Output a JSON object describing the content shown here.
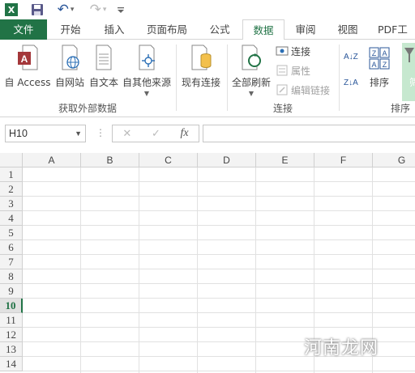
{
  "qat": {
    "logo_text": "X",
    "undo_symbol": "↶",
    "redo_symbol": "↷",
    "dropdown_symbol": "▾"
  },
  "tabs": [
    {
      "label": "文件"
    },
    {
      "label": "开始"
    },
    {
      "label": "插入"
    },
    {
      "label": "页面布局"
    },
    {
      "label": "公式"
    },
    {
      "label": "数据"
    },
    {
      "label": "审阅"
    },
    {
      "label": "视图"
    },
    {
      "label": "PDF工具"
    }
  ],
  "active_tab": "数据",
  "ribbon": {
    "get_external": {
      "buttons": [
        {
          "label": "自 Access"
        },
        {
          "label": "自网站"
        },
        {
          "label": "自文本"
        },
        {
          "label": "自其他来源"
        }
      ],
      "group_label": "获取外部数据"
    },
    "existing_connections": {
      "label": "现有连接"
    },
    "connections": {
      "refresh_all": "全部刷新",
      "connect": "连接",
      "properties": "属性",
      "edit_links": "编辑链接",
      "group_label": "连接"
    },
    "sort": {
      "az_label": "A↓Z",
      "za_label": "Z↓A",
      "sort_button": "排序",
      "filter_partial": "筛",
      "group_label": "排序"
    }
  },
  "formula_bar": {
    "name_box": "H10",
    "cancel_symbol": "✕",
    "enter_symbol": "✓",
    "fx_symbol": "fx",
    "formula": ""
  },
  "sheet": {
    "columns": [
      "A",
      "B",
      "C",
      "D",
      "E",
      "F",
      "G"
    ],
    "rows": [
      "1",
      "2",
      "3",
      "4",
      "5",
      "6",
      "7",
      "8",
      "9",
      "10",
      "11",
      "12",
      "13",
      "14"
    ],
    "active_row": "10"
  },
  "watermark": "河南龙网",
  "colors": {
    "accent": "#217346"
  }
}
